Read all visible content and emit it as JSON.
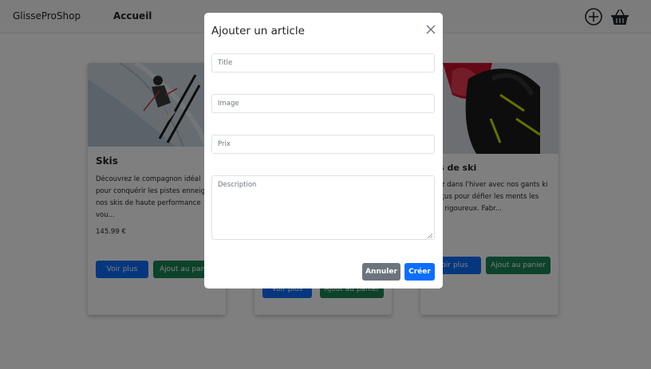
{
  "navbar": {
    "brand": "GlisseProShop",
    "link": "Accueil",
    "add_icon": "plus-circle-icon",
    "basket_icon": "basket-icon"
  },
  "cards": [
    {
      "title": "Skis",
      "description": "Découvrez le compagnon idéal pour conquérir les pistes enneig - nos skis de haute performance vou...",
      "price": "145.99 €",
      "button_more": "Voir plus",
      "button_cart": "Ajout au panier"
    },
    {
      "button_more": "Voir plus",
      "button_cart": "Ajout au panier"
    },
    {
      "title": "nts de ski",
      "description": "ngez dans l'hiver avec nos gants ki conçus pour défier les ments les plus rigoureux. Fabr...",
      "price": "9 €",
      "button_more": "oir plus",
      "button_cart": "Ajout au panier"
    }
  ],
  "modal": {
    "title": "Ajouter un article",
    "fields": {
      "title_placeholder": "Title",
      "image_placeholder": "Image",
      "price_placeholder": "Prix",
      "description_placeholder": "Description"
    },
    "cancel_label": "Annuler",
    "create_label": "Créer"
  },
  "colors": {
    "primary": "#0d6efd",
    "success": "#198754",
    "secondary": "#6c757d",
    "backdrop": "rgba(0,0,0,0.5)"
  }
}
